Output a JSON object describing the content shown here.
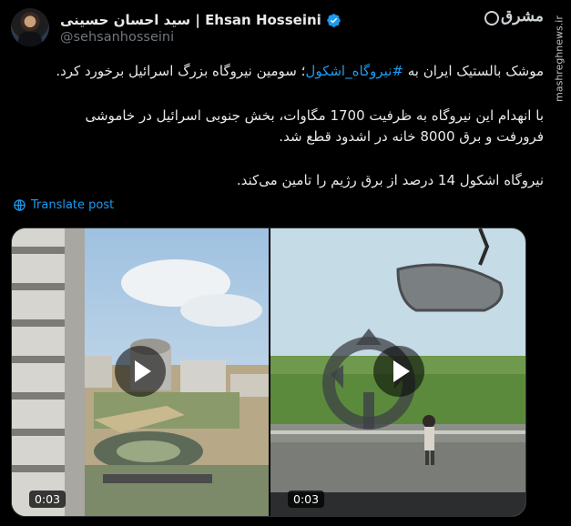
{
  "author": {
    "display_name": "سید احسان حسینی | Ehsan Hosseini",
    "handle": "@sehsanhosseini",
    "verified_color": "#1d9bf0"
  },
  "brand": {
    "name": "مشرق"
  },
  "watermark": {
    "text": "mashreghnews.ir"
  },
  "post": {
    "line1_pre": "موشک بالستیک ایران به ",
    "hashtag": "#نیروگاه_اشکول",
    "line1_post": "؛ سومین نیروگاه بزرگ اسرائیل برخورد کرد.",
    "line2": "با انهدام این نیروگاه به ظرفیت 1700 مگاوات، بخش جنوبی اسرائیل در خاموشی",
    "line3": "فرورفت و برق 8000 خانه در اشدود قطع شد.",
    "line4": "نیروگاه اشکول 14 درصد از برق رژیم را تامین می‌کند."
  },
  "translate": {
    "label": "Translate post"
  },
  "media": {
    "videos": [
      {
        "duration": "0:03",
        "icon": "play-icon"
      },
      {
        "duration": "0:03",
        "icon": "play-icon"
      }
    ]
  },
  "colors": {
    "accent": "#1d9bf0",
    "background": "#000000",
    "muted": "#71767b",
    "text": "#e7e9ea"
  }
}
